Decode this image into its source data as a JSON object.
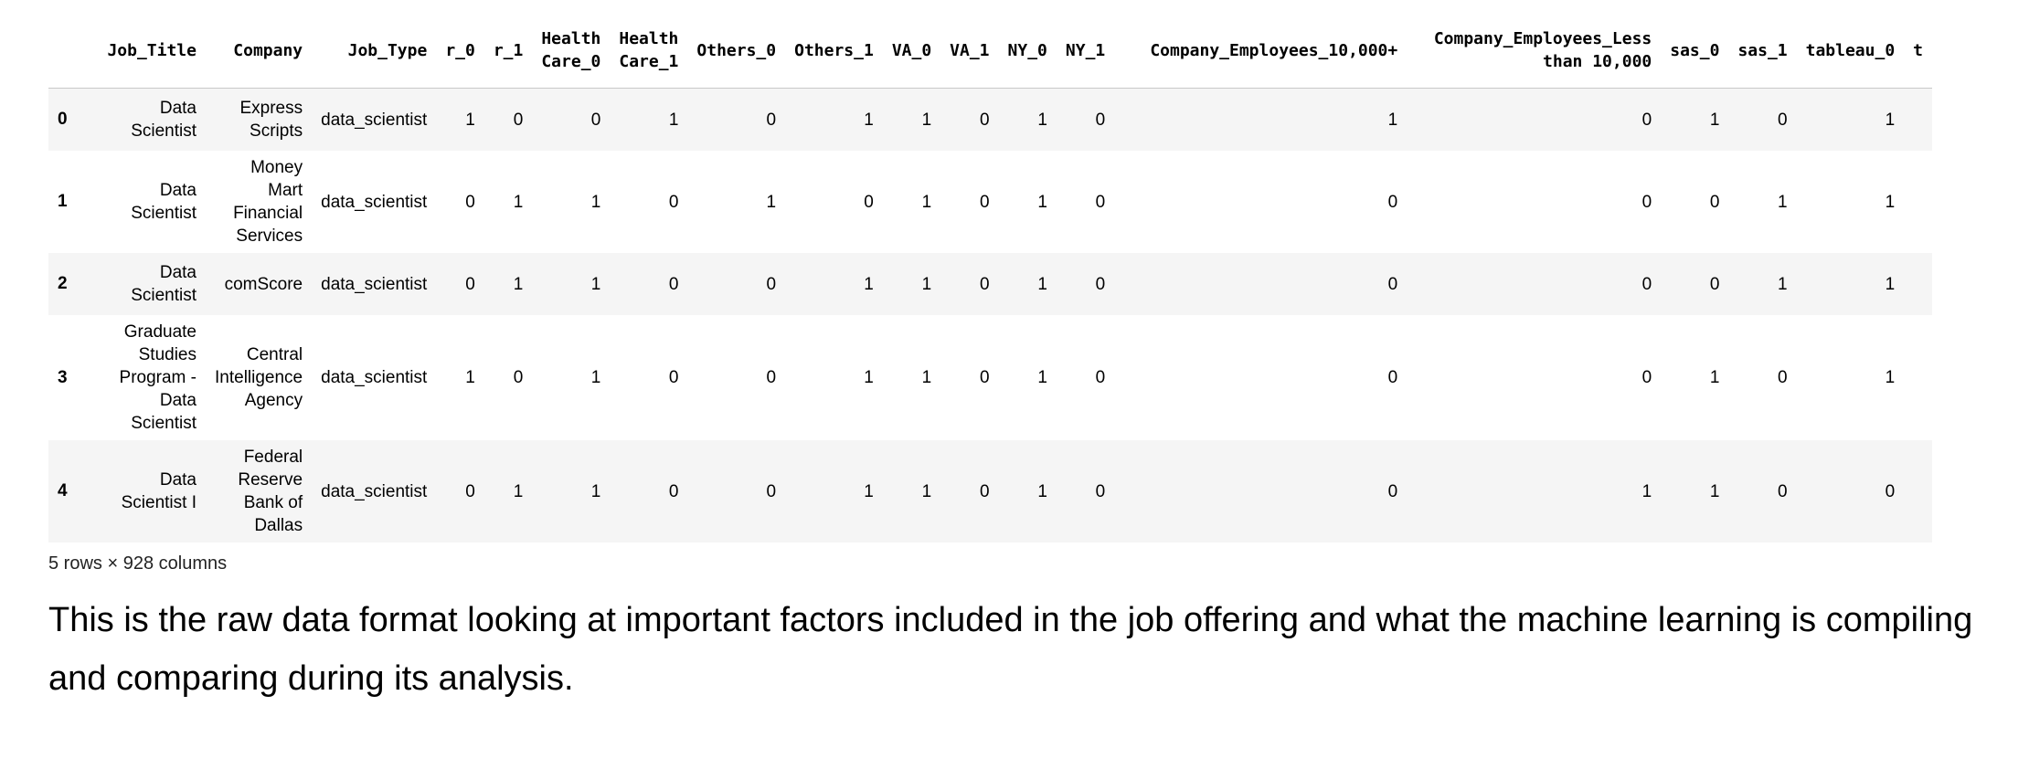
{
  "table": {
    "columns": [
      "Job_Title",
      "Company",
      "Job_Type",
      "r_0",
      "r_1",
      "Health\nCare_0",
      "Health\nCare_1",
      "Others_0",
      "Others_1",
      "VA_0",
      "VA_1",
      "NY_0",
      "NY_1",
      "Company_Employees_10,000+",
      "Company_Employees_Less\nthan 10,000",
      "sas_0",
      "sas_1",
      "tableau_0",
      "t"
    ],
    "rows": [
      {
        "index": "0",
        "cells": [
          "Data Scientist",
          "Express Scripts",
          "data_scientist",
          "1",
          "0",
          "0",
          "1",
          "0",
          "1",
          "1",
          "0",
          "1",
          "0",
          "1",
          "0",
          "1",
          "0",
          "1",
          ""
        ]
      },
      {
        "index": "1",
        "cells": [
          "Data Scientist",
          "Money Mart Financial Services",
          "data_scientist",
          "0",
          "1",
          "1",
          "0",
          "1",
          "0",
          "1",
          "0",
          "1",
          "0",
          "0",
          "0",
          "0",
          "1",
          "1",
          ""
        ]
      },
      {
        "index": "2",
        "cells": [
          "Data Scientist",
          "comScore",
          "data_scientist",
          "0",
          "1",
          "1",
          "0",
          "0",
          "1",
          "1",
          "0",
          "1",
          "0",
          "0",
          "0",
          "0",
          "1",
          "1",
          ""
        ]
      },
      {
        "index": "3",
        "cells": [
          "Graduate Studies Program - Data Scientist",
          "Central Intelligence Agency",
          "data_scientist",
          "1",
          "0",
          "1",
          "0",
          "0",
          "1",
          "1",
          "0",
          "1",
          "0",
          "0",
          "0",
          "1",
          "0",
          "1",
          ""
        ]
      },
      {
        "index": "4",
        "cells": [
          "Data Scientist I",
          "Federal Reserve Bank of Dallas",
          "data_scientist",
          "0",
          "1",
          "1",
          "0",
          "0",
          "1",
          "1",
          "0",
          "1",
          "0",
          "0",
          "1",
          "1",
          "0",
          "0",
          ""
        ]
      }
    ]
  },
  "shape_text": "5 rows × 928 columns",
  "caption": "This is the raw data format looking at important factors included in the job offering and what the machine learning is compiling and comparing during its analysis."
}
